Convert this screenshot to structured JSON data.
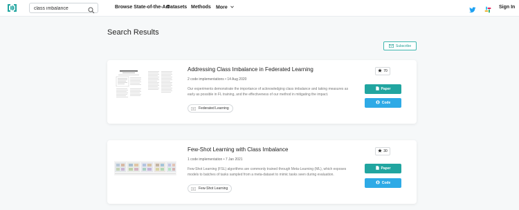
{
  "header": {
    "search_value": "class imbalance",
    "nav": [
      "Browse State-of-the-Art",
      "Datasets",
      "Methods",
      "More"
    ],
    "signin": "Sign In",
    "icons": [
      "logo-icon",
      "search-icon",
      "twitter-icon",
      "slack-icon",
      "chevron-down-icon"
    ]
  },
  "page": {
    "title": "Search Results",
    "subscribe": "Subscribe"
  },
  "colors": {
    "accent": "#21a5a0",
    "code": "#2eaae6",
    "subscribe": "#1f9f95",
    "twitter": "#1da1f2"
  },
  "results": [
    {
      "title": "Addressing Class Imbalance in Federated Learning",
      "meta": "2 code implementations • 14 Aug 2020",
      "abstract": "Our experiments demonstrate the importance of acknowledging class imbalance and taking measures as early as possible in FL training, and the effectiveness of our method in mitigating the impact.",
      "tag": "Federated Learning",
      "stars": "70",
      "paper": "Paper",
      "code": "Code"
    },
    {
      "title": "Few-Shot Learning with Class Imbalance",
      "meta": "1 code implementation • 7 Jan 2021",
      "abstract": "Few-Shot Learning (FSL) algorithms are commonly trained through Meta-Learning (ML), which exposes models to batches of tasks sampled from a meta-dataset to mimic tasks seen during evaluation.",
      "tag": "Few-Shot Learning",
      "stars": "30",
      "paper": "Paper",
      "code": "Code"
    }
  ]
}
